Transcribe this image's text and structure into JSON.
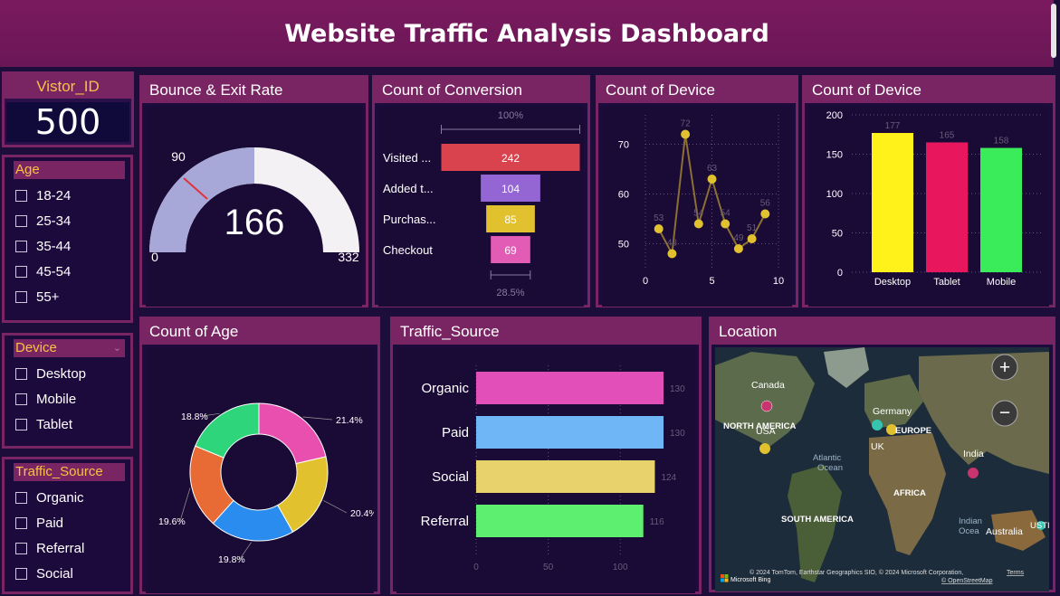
{
  "header": {
    "title": "Website Traffic Analysis Dashboard"
  },
  "kpi": {
    "label": "Vistor_ID",
    "value": "500"
  },
  "slicers": {
    "age": {
      "title": "Age",
      "items": [
        "18-24",
        "25-34",
        "35-44",
        "45-54",
        "55+"
      ]
    },
    "device": {
      "title": "Device",
      "items": [
        "Desktop",
        "Mobile",
        "Tablet"
      ]
    },
    "traffic": {
      "title": "Traffic_Source",
      "items": [
        "Organic",
        "Paid",
        "Referral",
        "Social"
      ]
    }
  },
  "gauge": {
    "title": "Bounce & Exit Rate",
    "value": "166",
    "min": "0",
    "max": "332",
    "target": "90"
  },
  "funnel": {
    "title": "Count of Conversion",
    "top_pct": "100%",
    "bottom_pct": "28.5%",
    "stages": [
      {
        "label": "Visited ...",
        "value": 242,
        "color": "#d9434e"
      },
      {
        "label": "Added t...",
        "value": 104,
        "color": "#9466d4"
      },
      {
        "label": "Purchas...",
        "value": 85,
        "color": "#e2c12f"
      },
      {
        "label": "Checkout",
        "value": 69,
        "color": "#e25bb5"
      }
    ]
  },
  "line_title": "Count of Device",
  "bar_title": "Count of Device",
  "donut_title": "Count of Age",
  "traffic_title": "Traffic_Source",
  "location": {
    "title": "Location",
    "labels": {
      "canada": "Canada",
      "germany": "Germany",
      "north_america": "NORTH AMERICA",
      "europe": "EUROPE",
      "usa": "USA",
      "uk": "UK",
      "atlantic": "Atlantic",
      "ocean": "Ocean",
      "india": "India",
      "africa": "AFRICA",
      "south_america": "SOUTH AMERICA",
      "indian": "Indian",
      "ocean2": "Ocea",
      "australia": "Australia",
      "austr_cut": "USTI"
    },
    "copyright": "© 2024 TomTom, Earthstar Geographics SIO, © 2024 Microsoft Corporation,",
    "terms": "Terms",
    "osm": "© OpenStreetMap",
    "bing": "Microsoft Bing"
  },
  "chart_data": [
    {
      "type": "line",
      "title": "Count of Device",
      "x": [
        1,
        2,
        3,
        4,
        5,
        6,
        7,
        8,
        9
      ],
      "y": [
        53,
        48,
        72,
        54,
        63,
        54,
        49,
        51,
        56
      ],
      "point_labels": [
        "53",
        "48",
        "72",
        "54",
        "63",
        "54",
        "49",
        "51",
        "56"
      ],
      "xlim": [
        0,
        10
      ],
      "ylim": [
        45,
        75
      ],
      "xticks": [
        "0",
        "5",
        "10"
      ],
      "yticks": [
        "50",
        "60",
        "70"
      ],
      "color": "#e2c12f"
    },
    {
      "type": "bar",
      "title": "Count of Device",
      "categories": [
        "Desktop",
        "Tablet",
        "Mobile"
      ],
      "values": [
        177,
        165,
        158
      ],
      "colors": [
        "#fff21a",
        "#e8175d",
        "#3aeb5a"
      ],
      "ylim": [
        0,
        200
      ],
      "yticks": [
        "0",
        "50",
        "100",
        "150",
        "200"
      ]
    },
    {
      "type": "pie",
      "title": "Count of Age",
      "labels": [
        "21.4%",
        "20.4%",
        "19.8%",
        "19.6%",
        "18.8%"
      ],
      "values": [
        21.4,
        20.4,
        19.8,
        19.6,
        18.8
      ],
      "colors": [
        "#e84fae",
        "#e2c12f",
        "#2b8cf0",
        "#e86a34",
        "#2ed57a"
      ]
    },
    {
      "type": "bar",
      "title": "Traffic_Source",
      "categories": [
        "Organic",
        "Paid",
        "Social",
        "Referral"
      ],
      "values": [
        130,
        130,
        124,
        116
      ],
      "colors": [
        "#e24fb8",
        "#6fb6f7",
        "#e8d26b",
        "#5df070"
      ],
      "xlim": [
        0,
        130
      ],
      "xticks": [
        "0",
        "50",
        "100"
      ]
    }
  ]
}
